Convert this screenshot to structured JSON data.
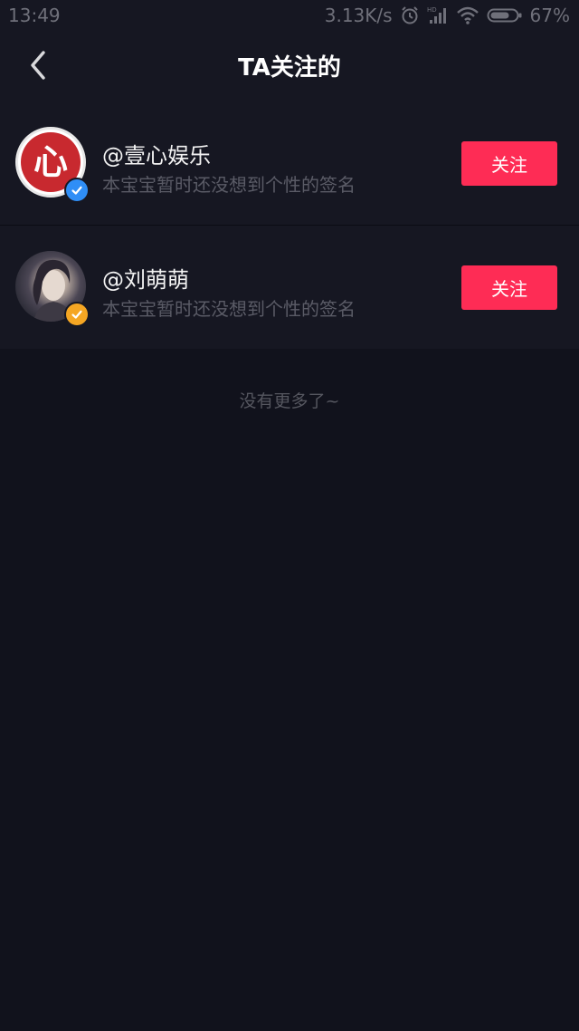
{
  "status_bar": {
    "time": "13:49",
    "network_speed": "3.13K/s",
    "battery": "67%",
    "icons": [
      "alarm-icon",
      "hd-signal-icon",
      "wifi-icon",
      "battery-icon"
    ]
  },
  "header": {
    "title": "TA关注的",
    "back_icon": "chevron-left-icon"
  },
  "users": [
    {
      "username": "@壹心娱乐",
      "signature": "本宝宝暂时还没想到个性的签名",
      "follow_label": "关注",
      "avatar_text": "心",
      "badge_color": "#2f8ef6"
    },
    {
      "username": "@刘萌萌",
      "signature": "本宝宝暂时还没想到个性的签名",
      "follow_label": "关注",
      "badge_color": "#f5a623"
    }
  ],
  "end_text": "没有更多了~",
  "colors": {
    "background": "#11121c",
    "surface": "#161722",
    "accent": "#fe2c55"
  }
}
